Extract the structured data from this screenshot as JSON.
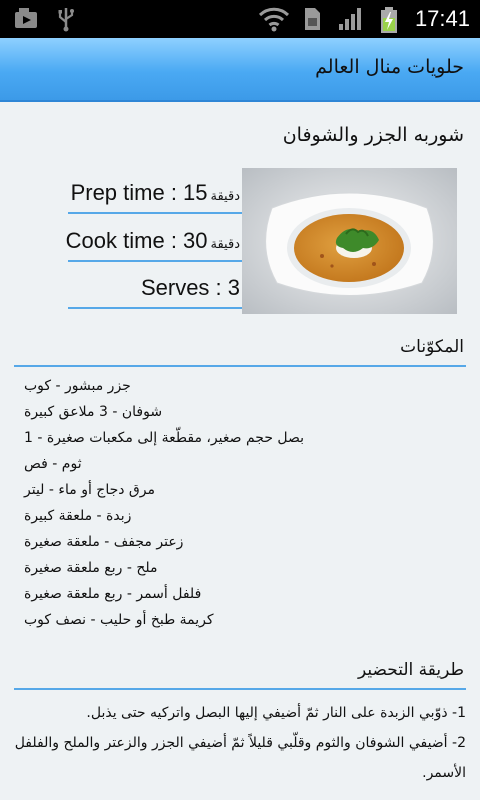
{
  "status_bar": {
    "time": "17:41",
    "icons": [
      "image-notification-icon",
      "usb-icon",
      "wifi-icon",
      "sim-icon",
      "signal-icon",
      "battery-charging-icon"
    ]
  },
  "app": {
    "title": "حلويات منال العالم",
    "accent": "#56a8e8"
  },
  "recipe": {
    "title": "شوربه الجزر والشوفان",
    "prep_label": "Prep time : 15",
    "prep_unit": "دقيقة",
    "cook_label": "Cook time : 30",
    "cook_unit": "دقيقة",
    "serves_label": "Serves : 3",
    "ingredients_heading": "المكوّنات",
    "ingredients": [
      "جزر مبشور - كوب",
      "شوفان - 3 ملاعق كبيرة",
      "بصل حجم صغير، مقطّعة إلى مكعبات صغيرة - 1",
      "ثوم - فص",
      "مرق دجاج أو ماء - ليتر",
      "زبدة - ملعقة كبيرة",
      "زعتر مجفف - ملعقة صغيرة",
      "ملح - ربع ملعقة صغيرة",
      "فلفل أسمر - ربع ملعقة صغيرة",
      "كريمة طبخ أو حليب - نصف كوب"
    ],
    "method_heading": "طريقة التحضير",
    "steps": [
      "1- ذوّبي الزبدة على النار ثمّ أضيفي إليها البصل واتركيه حتى يذبل.",
      "2- أضيفي الشوفان والثوم وقلّبي قليلاً ثمّ أضيفي الجزر والزعتر والملح والفلفل الأسمر."
    ]
  }
}
